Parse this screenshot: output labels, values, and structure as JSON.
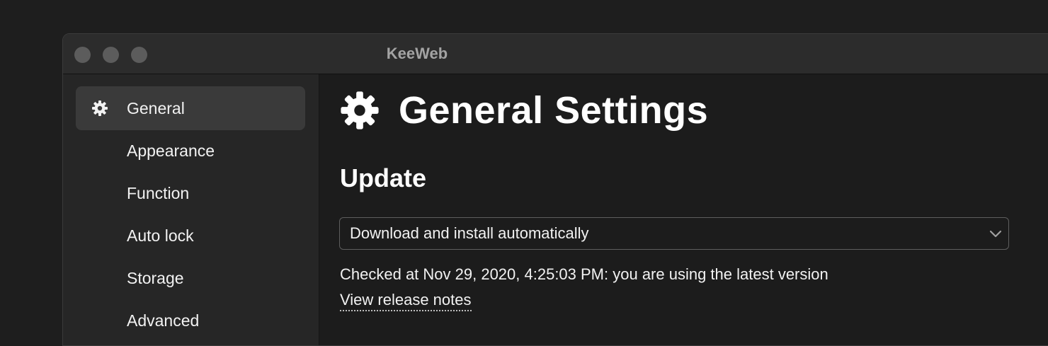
{
  "window": {
    "title": "KeeWeb"
  },
  "sidebar": {
    "items": [
      {
        "label": "General",
        "icon": "gear-icon",
        "active": true
      },
      {
        "label": "Appearance"
      },
      {
        "label": "Function"
      },
      {
        "label": "Auto lock"
      },
      {
        "label": "Storage"
      },
      {
        "label": "Advanced"
      }
    ]
  },
  "main": {
    "title": "General Settings",
    "title_icon": "gear-icon",
    "update": {
      "heading": "Update",
      "select_value": "Download and install automatically",
      "status": "Checked at Nov 29, 2020, 4:25:03 PM: you are using the latest version",
      "release_notes_link": "View release notes"
    }
  },
  "colors": {
    "background": "#1e1e1e",
    "titlebar": "#2c2c2c",
    "sidebar": "#262626",
    "active_item": "#3a3a3a",
    "text": "#f2f2f2"
  }
}
